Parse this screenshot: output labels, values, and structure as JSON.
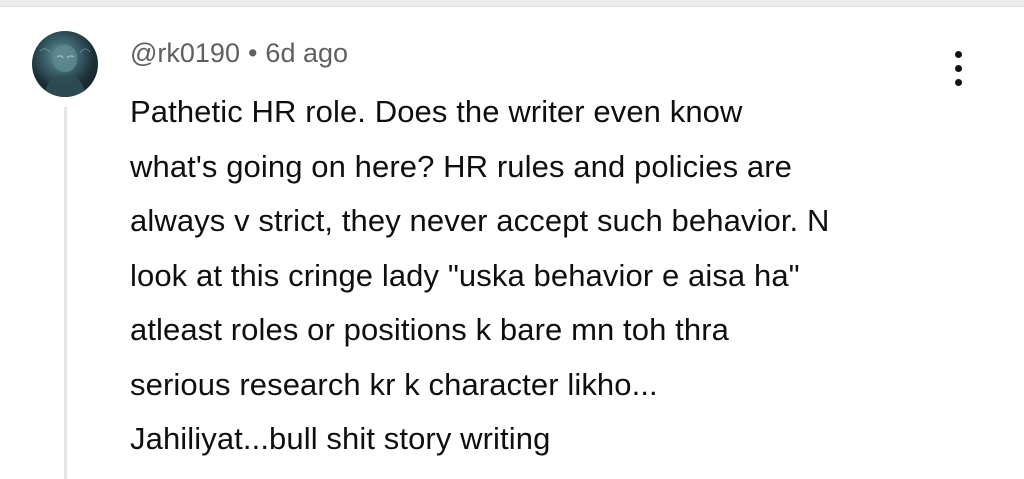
{
  "comment": {
    "author": "@rk0190",
    "separator": "•",
    "timestamp": "6d ago",
    "avatar_icon": "avatar-image",
    "menu_icon": "more-vert-icon",
    "body_lines": [
      "Pathetic HR role. Does the writer even know",
      "what's going on here? HR rules and policies are",
      "always v strict, they never accept such behavior. N",
      "look at this cringe lady \"uska behavior e aisa ha\"",
      "atleast roles or positions k bare mn toh thra",
      "serious research kr k character likho...",
      "Jahiliyat...bull shit story writing"
    ]
  },
  "colors": {
    "text_primary": "#0f0f0f",
    "text_secondary": "#606060",
    "thread_line": "#e5e5e5",
    "divider": "#ececec"
  }
}
